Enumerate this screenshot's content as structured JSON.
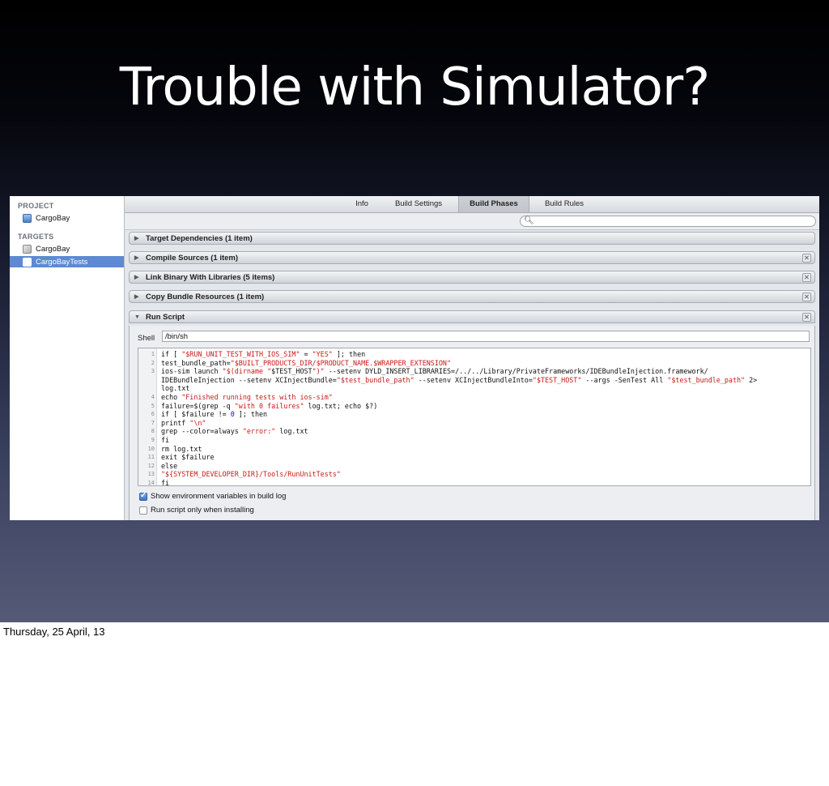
{
  "slide": {
    "title": "Trouble with Simulator?",
    "footer": "Thursday, 25 April, 13"
  },
  "sidebar": {
    "project_header": "PROJECT",
    "project_item": "CargoBay",
    "targets_header": "TARGETS",
    "targets": [
      {
        "label": "CargoBay",
        "icon": "app-target-icon"
      },
      {
        "label": "CargoBayTests",
        "icon": "test-target-icon",
        "selected": true
      }
    ]
  },
  "tabs": [
    {
      "label": "Info"
    },
    {
      "label": "Build Settings"
    },
    {
      "label": "Build Phases",
      "active": true
    },
    {
      "label": "Build Rules"
    }
  ],
  "search": {
    "icon": "search-icon",
    "placeholder": ""
  },
  "phases": [
    {
      "title": "Target Dependencies (1 item)"
    },
    {
      "title": "Compile Sources (1 item)"
    },
    {
      "title": "Link Binary With Libraries (5 items)"
    },
    {
      "title": "Copy Bundle Resources (1 item)"
    },
    {
      "title": "Run Script"
    }
  ],
  "run_script": {
    "shell_label": "Shell",
    "shell_value": "/bin/sh",
    "code_lines": [
      {
        "n": "1",
        "text": "if [ \"$RUN_UNIT_TEST_WITH_IOS_SIM\" = \"YES\" ]; then"
      },
      {
        "n": "2",
        "text": "test_bundle_path=\"$BUILT_PRODUCTS_DIR/$PRODUCT_NAME.$WRAPPER_EXTENSION\""
      },
      {
        "n": "3",
        "text": "ios-sim launch \"$(dirname \"$TEST_HOST\")\" --setenv DYLD_INSERT_LIBRARIES=/../../Library/PrivateFrameworks/IDEBundleInjection.framework/"
      },
      {
        "n": "",
        "text": "IDEBundleInjection --setenv XCInjectBundle=\"$test_bundle_path\" --setenv XCInjectBundleInto=\"$TEST_HOST\" --args -SenTest All \"$test_bundle_path\" 2>"
      },
      {
        "n": "",
        "text": "log.txt"
      },
      {
        "n": "4",
        "text": "echo \"Finished running tests with ios-sim\""
      },
      {
        "n": "5",
        "text": "failure=$(grep -q \"with 0 failures\" log.txt; echo $?)"
      },
      {
        "n": "6",
        "text": "if [ $failure != 0 ]; then"
      },
      {
        "n": "7",
        "text": "printf \"\\n\""
      },
      {
        "n": "8",
        "text": "grep --color=always \"error:\" log.txt"
      },
      {
        "n": "9",
        "text": "fi"
      },
      {
        "n": "10",
        "text": "rm log.txt"
      },
      {
        "n": "11",
        "text": "exit $failure"
      },
      {
        "n": "12",
        "text": "else"
      },
      {
        "n": "13",
        "text": "\"${SYSTEM_DEVELOPER_DIR}/Tools/RunUnitTests\""
      },
      {
        "n": "14",
        "text": "fi"
      }
    ],
    "options": [
      {
        "label": "Show environment variables in build log",
        "checked": true
      },
      {
        "label": "Run script only when installing",
        "checked": false
      }
    ]
  },
  "colors": {
    "string": "#c41a16",
    "number": "#1c00cf",
    "selection": "#5d8ad2"
  }
}
